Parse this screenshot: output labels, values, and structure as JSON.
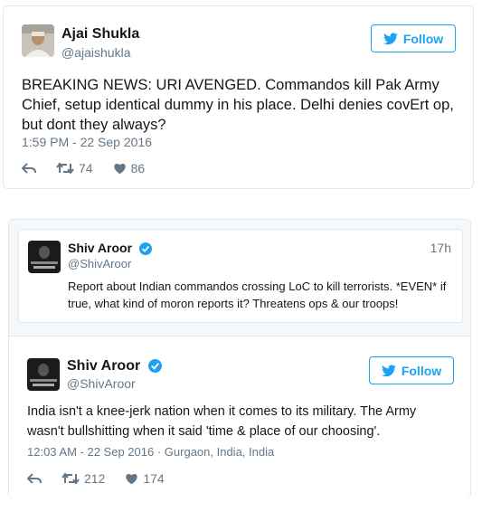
{
  "tweet1": {
    "name": "Ajai Shukla",
    "handle": "@ajaishukla",
    "follow_label": "Follow",
    "text": "BREAKING NEWS: URI AVENGED. Commandos kill Pak Army Chief, setup identical dummy in his place. Delhi denies covErt op, but dont they always?",
    "timestamp": "1:59 PM - 22 Sep 2016",
    "retweets": "74",
    "likes": "86"
  },
  "quoted": {
    "name": "Shiv Aroor",
    "handle": "@ShivAroor",
    "time": "17h",
    "text": "Report about Indian commandos crossing LoC to kill terrorists. *EVEN* if true, what kind of moron reports it? Threatens ops & our troops!"
  },
  "tweet2": {
    "name": "Shiv Aroor",
    "handle": "@ShivAroor",
    "follow_label": "Follow",
    "text": "India isn't a knee-jerk nation when it comes to its military. The Army wasn't bullshitting when it said 'time & place of our choosing'.",
    "timestamp": "12:03 AM - 22 Sep 2016",
    "location": "Gurgaon, India, India",
    "retweets": "212",
    "likes": "174"
  },
  "colors": {
    "accent": "#1da1f2",
    "muted": "#657786",
    "text": "#14171a"
  },
  "icons": [
    "twitter-bird-icon",
    "reply-icon",
    "retweet-icon",
    "heart-icon",
    "verified-icon"
  ]
}
